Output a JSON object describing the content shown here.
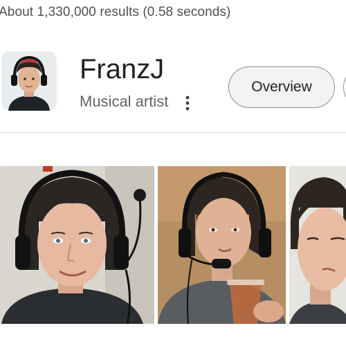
{
  "results": {
    "stats_text": "About 1,330,000 results (0.58 seconds)"
  },
  "knowledge_panel": {
    "title": "FranzJ",
    "subtitle": "Musical artist",
    "more_icon": "more-vert-icon",
    "tabs": [
      {
        "label": "Overview",
        "selected": true
      }
    ]
  },
  "images": [
    {
      "subject": "person-with-headset"
    },
    {
      "subject": "person-with-headset-and-cup"
    },
    {
      "subject": "person-squinting"
    }
  ],
  "colors": {
    "text_primary": "#202124",
    "text_secondary": "#5f6368",
    "stats_text": "#4d5156",
    "divider": "#dadce0",
    "chip_bg": "#f1f3f4",
    "chip_border": "#8a8d91"
  }
}
